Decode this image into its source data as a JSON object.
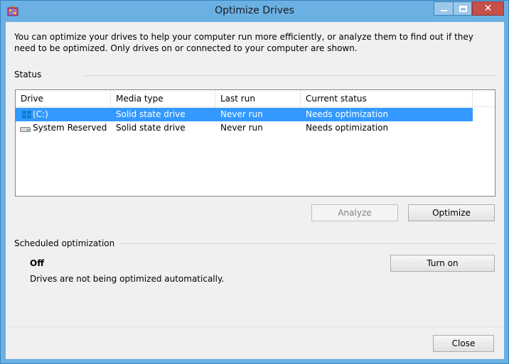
{
  "window": {
    "title": "Optimize Drives",
    "close_glyph": "✕"
  },
  "intro_text": "You can optimize your drives to help your computer run more efficiently, or analyze them to find out if they need to be optimized. Only drives on or connected to your computer are shown.",
  "status_section": {
    "label": "Status",
    "columns": [
      "Drive",
      "Media type",
      "Last run",
      "Current status"
    ],
    "rows": [
      {
        "drive": "(C:)",
        "icon": "windows-drive-icon",
        "media_type": "Solid state drive",
        "last_run": "Never run",
        "status": "Needs optimization",
        "selected": true
      },
      {
        "drive": "System Reserved",
        "icon": "hard-drive-icon",
        "media_type": "Solid state drive",
        "last_run": "Never run",
        "status": "Needs optimization",
        "selected": false
      }
    ],
    "analyze_label": "Analyze",
    "optimize_label": "Optimize"
  },
  "scheduled_section": {
    "label": "Scheduled optimization",
    "state": "Off",
    "description": "Drives are not being optimized automatically.",
    "turn_on_label": "Turn on"
  },
  "footer": {
    "close_label": "Close"
  },
  "colors": {
    "titlebar": "#6ab0e3",
    "selection": "#3399ff",
    "close_button": "#c7504a"
  }
}
